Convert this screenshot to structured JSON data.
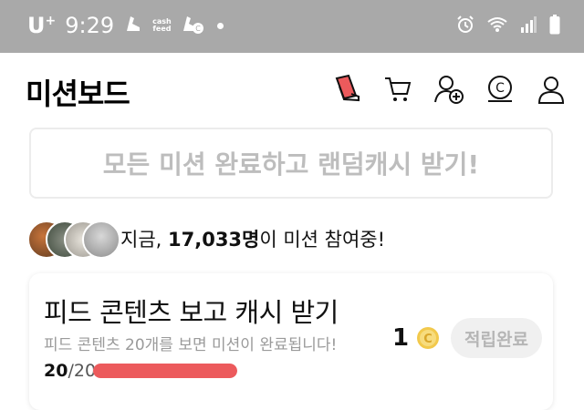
{
  "statusbar": {
    "carrier": "U",
    "carrier_sup": "+",
    "time": "9:29",
    "app_label_line1": "cash",
    "app_label_line2": "feed"
  },
  "header": {
    "title": "미션보드",
    "icons": [
      "sticker-phone-icon",
      "cart-icon",
      "add-friend-icon",
      "coin-wallet-icon",
      "profile-icon"
    ]
  },
  "banner": {
    "text": "모든 미션 완료하고 랜덤캐시 받기!"
  },
  "participants": {
    "prefix": "지금, ",
    "count": "17,033명",
    "suffix": "이 미션 참여중!"
  },
  "mission": {
    "title": "피드 콘텐츠 보고 캐시 받기",
    "description": "피드 콘텐츠 20개를 보면 미션이 완료됩니다!",
    "progress_current": "20",
    "progress_total": "/20",
    "progress_fraction": 1.0,
    "reward": "1",
    "claim_label": "적립완료"
  },
  "colors": {
    "statusbar": "#a9a9a9",
    "accent_progress": "#ec5a5c",
    "coin": "#f2c94c"
  }
}
